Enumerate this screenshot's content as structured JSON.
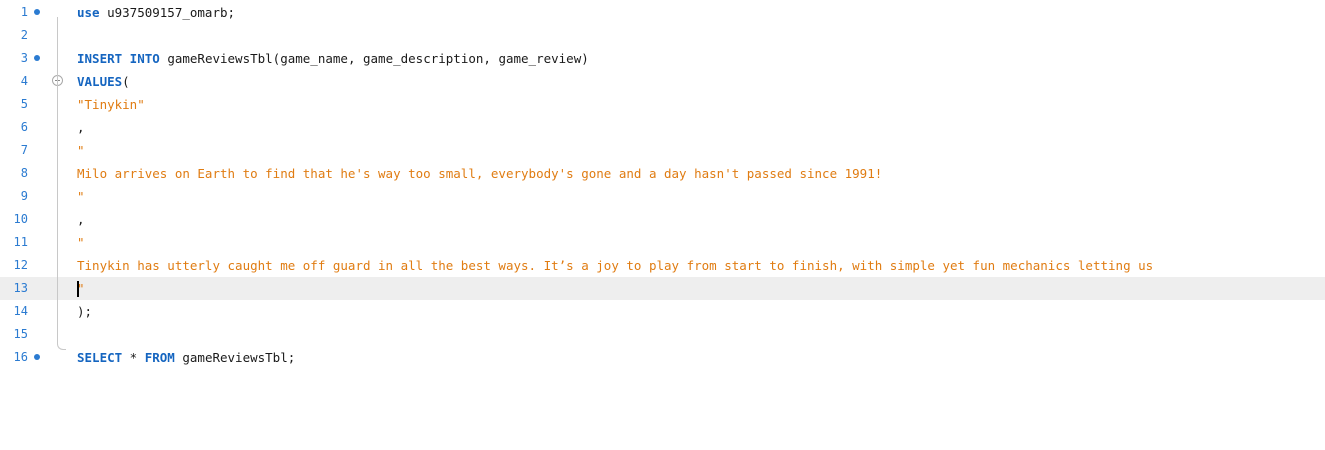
{
  "editor": {
    "lines": [
      {
        "num": "1",
        "bullet": true,
        "parts": [
          {
            "t": "use",
            "c": "kw"
          },
          {
            "t": " u937509157_omarb;",
            "c": "plain"
          }
        ]
      },
      {
        "num": "2",
        "bullet": false,
        "parts": []
      },
      {
        "num": "3",
        "bullet": true,
        "parts": [
          {
            "t": "INSERT INTO",
            "c": "kw"
          },
          {
            "t": " gameReviewsTbl(game_name, game_description, game_review)",
            "c": "plain"
          }
        ]
      },
      {
        "num": "4",
        "bullet": false,
        "parts": [
          {
            "t": "VALUES",
            "c": "kw"
          },
          {
            "t": "(",
            "c": "plain"
          }
        ]
      },
      {
        "num": "5",
        "bullet": false,
        "parts": [
          {
            "t": "\"Tinykin\"",
            "c": "str"
          }
        ]
      },
      {
        "num": "6",
        "bullet": false,
        "parts": [
          {
            "t": ",",
            "c": "plain"
          }
        ]
      },
      {
        "num": "7",
        "bullet": false,
        "parts": [
          {
            "t": "\"",
            "c": "str"
          }
        ]
      },
      {
        "num": "8",
        "bullet": false,
        "parts": [
          {
            "t": "Milo arrives on Earth to find that he's way too small, everybody's gone and a day hasn't passed since 1991!",
            "c": "str"
          }
        ]
      },
      {
        "num": "9",
        "bullet": false,
        "parts": [
          {
            "t": "\"",
            "c": "str"
          }
        ]
      },
      {
        "num": "10",
        "bullet": false,
        "parts": [
          {
            "t": ",",
            "c": "plain"
          }
        ]
      },
      {
        "num": "11",
        "bullet": false,
        "parts": [
          {
            "t": "\"",
            "c": "str"
          }
        ]
      },
      {
        "num": "12",
        "bullet": false,
        "parts": [
          {
            "t": "Tinykin has utterly caught me off guard in all the best ways. It’s a joy to play from start to finish, with simple yet fun mechanics letting us",
            "c": "str"
          }
        ]
      },
      {
        "num": "13",
        "bullet": false,
        "parts": [
          {
            "t": "\"",
            "c": "str"
          }
        ]
      },
      {
        "num": "14",
        "bullet": false,
        "parts": [
          {
            "t": ");",
            "c": "plain"
          }
        ]
      },
      {
        "num": "15",
        "bullet": false,
        "parts": []
      },
      {
        "num": "16",
        "bullet": true,
        "parts": [
          {
            "t": "SELECT",
            "c": "kw"
          },
          {
            "t": " * ",
            "c": "plain"
          },
          {
            "t": "FROM",
            "c": "kw"
          },
          {
            "t": " gameReviewsTbl;",
            "c": "plain"
          }
        ]
      }
    ],
    "current_line": 13,
    "fold_start_line": 4,
    "fold_end_line": 14,
    "colors": {
      "keyword": "#1565c0",
      "string": "#e07c12",
      "line_number": "#2b7bd1",
      "current_line_bg": "#eeeeee"
    }
  }
}
